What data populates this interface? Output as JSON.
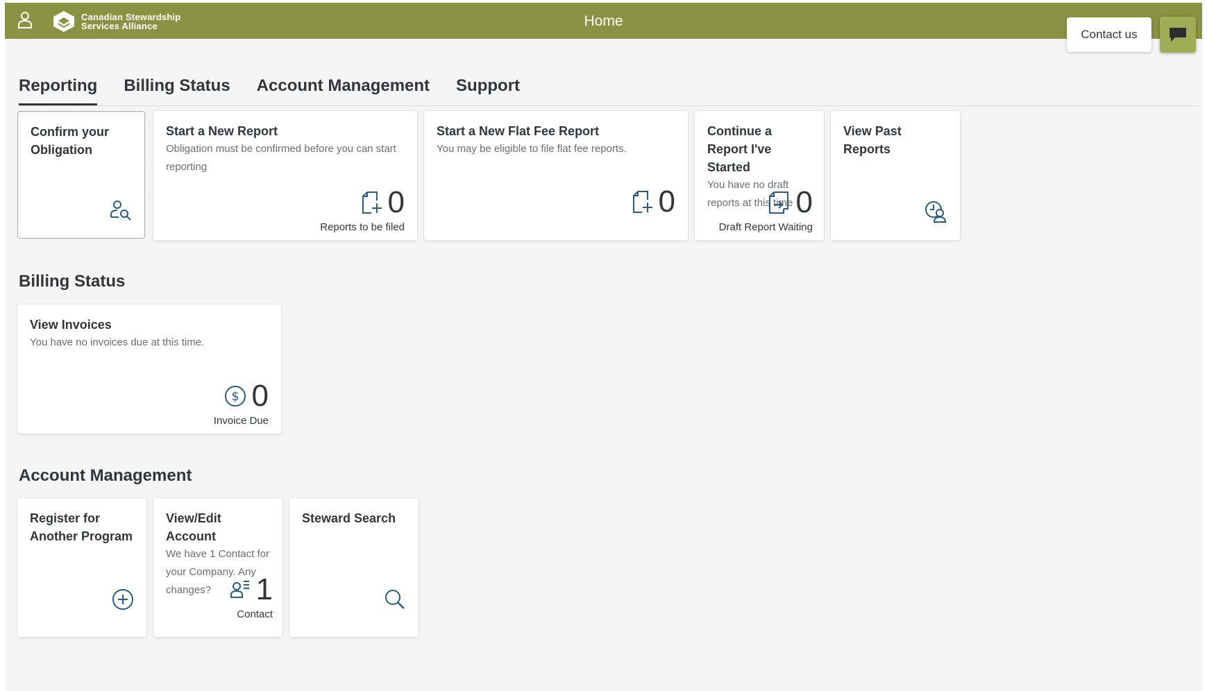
{
  "shell": {
    "title": "Home",
    "logo_line1": "Canadian Stewardship",
    "logo_line2": "Services Alliance",
    "contact_label": "Contact us"
  },
  "tabs": [
    {
      "label": "Reporting",
      "active": true
    },
    {
      "label": "Billing Status",
      "active": false
    },
    {
      "label": "Account Management",
      "active": false
    },
    {
      "label": "Support",
      "active": false
    }
  ],
  "reporting": {
    "confirm": {
      "title": "Confirm your Obligation",
      "icon": "user-search-icon"
    },
    "new_report": {
      "title": "Start a New Report",
      "subtitle": "Obligation must be confirmed before you can start reporting",
      "count": "0",
      "unit": "Reports to be filed",
      "icon": "add-document-icon"
    },
    "flat_fee": {
      "title": "Start a New Flat Fee Report",
      "subtitle": "You may be eligible to file flat fee reports.",
      "count": "0",
      "icon": "add-document-icon"
    },
    "continue": {
      "title": "Continue a Report I've Started",
      "subtitle": "You have no draft reports at this time",
      "count": "0",
      "unit": "Draft Report Waiting",
      "icon": "document-arrow-icon"
    },
    "past": {
      "title": "View Past Reports",
      "icon": "history-user-icon"
    }
  },
  "billing": {
    "section_title": "Billing Status",
    "invoices": {
      "title": "View Invoices",
      "subtitle": "You have no invoices due at this time.",
      "count": "0",
      "unit": "Invoice Due",
      "icon": "dollar-icon"
    }
  },
  "account": {
    "section_title": "Account Management",
    "register": {
      "title": "Register for Another Program",
      "icon": "add-circle-icon"
    },
    "edit": {
      "title": "View/Edit Account",
      "subtitle": "We have 1 Contact for your Company. Any changes?",
      "count": "1",
      "unit": "Contact",
      "icon": "user-list-icon"
    },
    "search": {
      "title": "Steward Search",
      "icon": "search-icon"
    }
  },
  "colors": {
    "shellbar": "#8a9243",
    "icon_blue": "#2a5a82",
    "chat": "#9fae56"
  }
}
